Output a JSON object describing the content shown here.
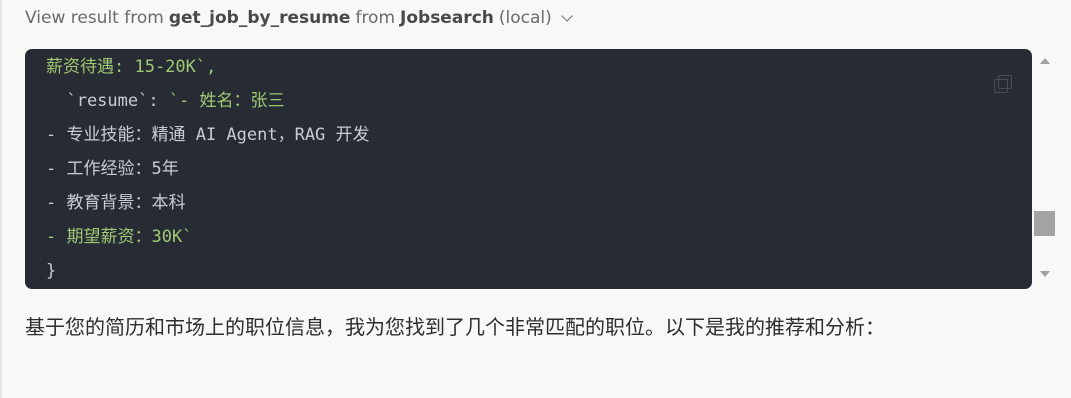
{
  "header": {
    "prefix": "View result from",
    "tool": "get_job_by_resume",
    "middle": "from",
    "server": "Jobsearch",
    "suffix": "(local)"
  },
  "code": {
    "lines": [
      "薪资待遇: 15-20K`,",
      "  `resume`: `- 姓名：张三",
      "- 专业技能：精通 AI Agent，RAG 开发",
      "- 工作经验：5年",
      "- 教育背景：本科",
      "- 期望薪资：30K`",
      "}"
    ]
  },
  "response": {
    "text": "基于您的简历和市场上的职位信息，我为您找到了几个非常匹配的职位。以下是我的推荐和分析："
  },
  "colors": {
    "page_bg": "#f8f8f6",
    "code_bg": "#272b34",
    "code_text": "#c9ccd3",
    "code_string": "#9fc873"
  },
  "icons": {
    "expand": "chevron-down-icon",
    "copy": "copy-icon"
  }
}
